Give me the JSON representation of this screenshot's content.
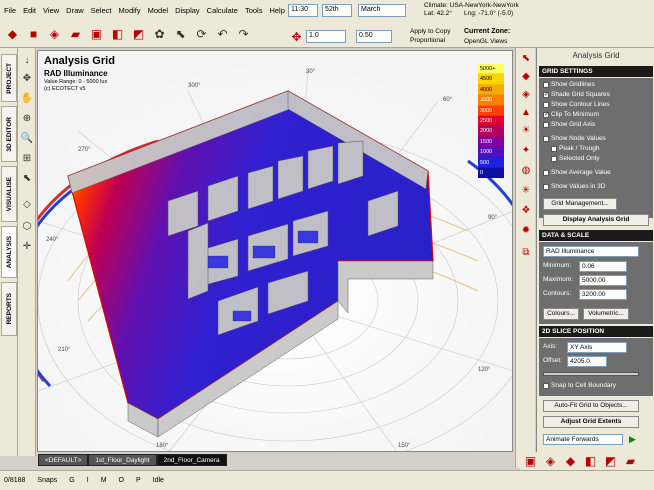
{
  "menu": [
    "File",
    "Edit",
    "View",
    "Draw",
    "Select",
    "Modify",
    "Model",
    "Display",
    "Calculate",
    "Tools",
    "Help"
  ],
  "topbar": {
    "time": "11:30",
    "day": "52th",
    "month": "March",
    "climate_label": "Climate: USA-NewYork-NewYork",
    "lat_label": "Lat: 42.2°",
    "long_label": "Lng: -71.0° (-5.0)",
    "scale_value": "1.0",
    "offset_value": "0.50",
    "apply_to_copy": "Apply to Copy",
    "proportional": "Proportional",
    "current_zone": "Current Zone:",
    "views_label": "OpenGL Views"
  },
  "left_tabs": [
    "PROJECT",
    "3D EDITOR",
    "VISUALISE",
    "ANALYSIS",
    "REPORTS"
  ],
  "viewport": {
    "title": "Analysis Grid",
    "subtitle": "RAD Illuminance",
    "range": "Value Range: 0 - 5000 lux",
    "credit": "(c) ECOTECT v5",
    "compass_labels": [
      "300°",
      "270°",
      "240°",
      "210°",
      "180°",
      "150°",
      "120°",
      "90°",
      "60°",
      "30°"
    ]
  },
  "legend": {
    "items": [
      "5000+",
      "4500",
      "4000",
      "3500",
      "3000",
      "2500",
      "2000",
      "1500",
      "1000",
      "500",
      "0"
    ],
    "colors": [
      "#ffff66",
      "#ffd400",
      "#ffaa00",
      "#ff7f00",
      "#ff4000",
      "#e00030",
      "#b00060",
      "#8000a0",
      "#5010c0",
      "#2020e0",
      "#1010a0"
    ]
  },
  "bottom_tabs": [
    "<DEFAULT>",
    "1st_Floor_Daylight",
    "2nd_Floor_Camera"
  ],
  "status": {
    "coords": "0/8188",
    "snaps": "Snaps",
    "g": "G",
    "i": "I",
    "m": "M",
    "o": "O",
    "p": "P",
    "idle": "Idle"
  },
  "panel": {
    "title": "Analysis Grid",
    "grid_settings": "GRID SETTINGS",
    "show_gridlines": "Show Gridlines",
    "shade_grid_squares": "Shade Grid Squares",
    "show_contour_lines": "Show Contour Lines",
    "clip_to_minimum": "Clip To Minimum",
    "show_grid_axis": "Show Grid Axis",
    "show_node_values": "Show Node Values",
    "peak_trough": "Peak / Trough",
    "selected_only": "Selected Only",
    "show_average_value": "Show Average Value",
    "show_values_in_3d": "Show Values in 3D",
    "grid_management": "Grid Management...",
    "display_analysis_grid": "Display Analysis Grid",
    "data_scale": "DATA & SCALE",
    "data_type": "RAD Illuminance",
    "minimum_label": "Minimum:",
    "minimum_value": "0.06",
    "maximum_label": "Maximum:",
    "maximum_value": "5000.00",
    "contours_label": "Contours:",
    "contours_value": "3200.00",
    "colours_button": "Colours...",
    "volumetric_button": "Volumetric...",
    "slice_position": "2D SLICE POSITION",
    "axis_label": "Axis:",
    "axis_value": "XY Axis",
    "offset_label": "Offset:",
    "offset_value": "4205.0",
    "snap_to_cell": "Snap to Cell Boundary",
    "auto_fit": "Auto-Fit Grid to Objects...",
    "adjust_grid_extents": "Adjust Grid Extents",
    "animate": "Animate Forwards"
  }
}
